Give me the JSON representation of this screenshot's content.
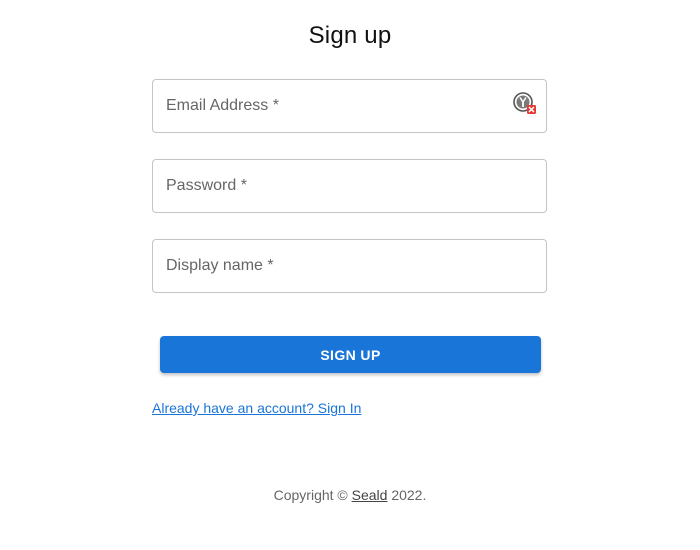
{
  "form": {
    "title": "Sign up",
    "fields": [
      {
        "label": "Email Address *",
        "value": ""
      },
      {
        "label": "Password *",
        "value": ""
      },
      {
        "label": "Display name *",
        "value": ""
      }
    ],
    "email_icon": "password-manager-icon",
    "submit_label": "SIGN UP",
    "signin_link": "Already have an account? Sign In"
  },
  "footer": {
    "prefix": "Copyright © ",
    "brand": "Seald",
    "suffix": " 2022."
  },
  "colors": {
    "primary": "#1a75d8",
    "border": "#c4c4c4",
    "label": "#666666",
    "icon_badge": "#e53935"
  }
}
